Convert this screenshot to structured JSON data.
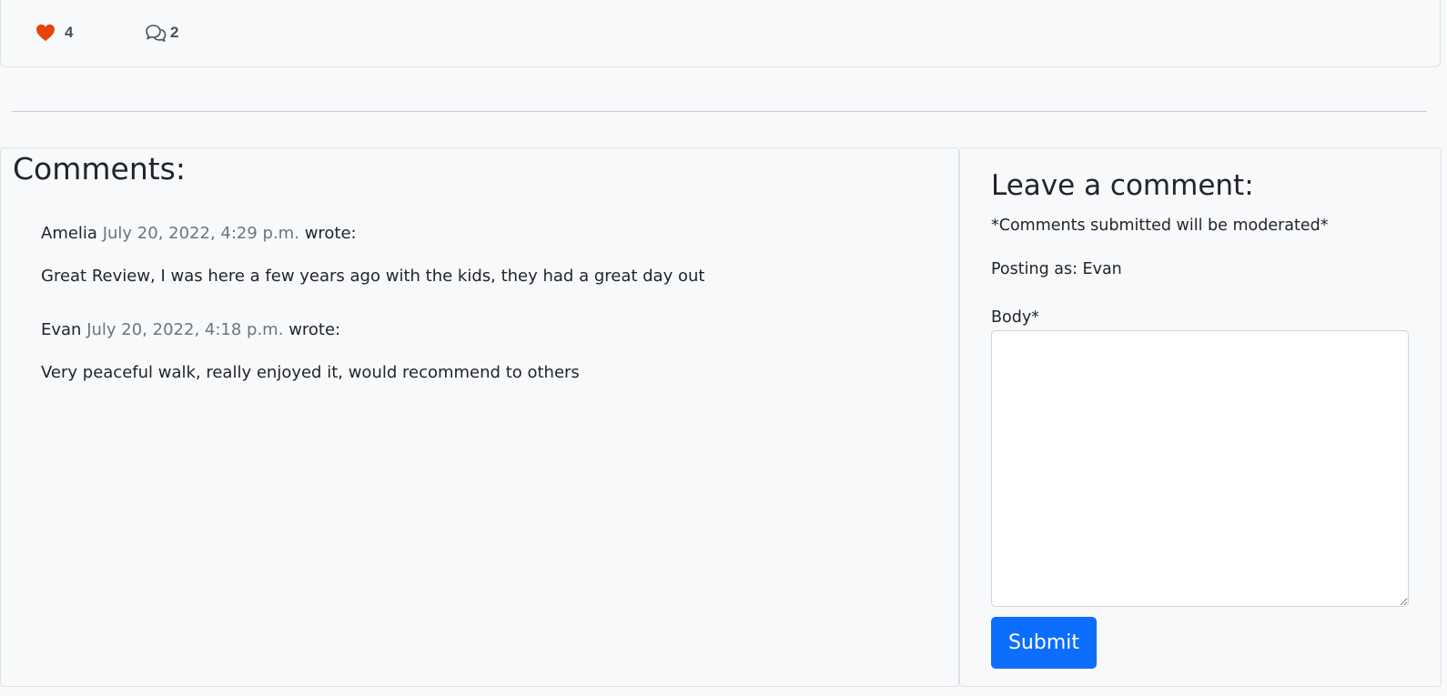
{
  "post_stats": {
    "likes_count": "4",
    "comments_count": "2",
    "like_icon": "heart-icon",
    "comment_icon": "chat-bubbles-icon",
    "like_color": "#e8430e"
  },
  "comments_section": {
    "heading": "Comments:",
    "comments": [
      {
        "author": "Amelia",
        "date": "July 20, 2022, 4:29 p.m.",
        "wrote": "wrote:",
        "body": "Great Review, I was here a few years ago with the kids, they had a great day out"
      },
      {
        "author": "Evan",
        "date": "July 20, 2022, 4:18 p.m.",
        "wrote": "wrote:",
        "body": "Very peaceful walk, really enjoyed it, would recommend to others"
      }
    ]
  },
  "comment_form": {
    "heading": "Leave a comment:",
    "moderation_note": "*Comments submitted will be moderated*",
    "posting_as": "Posting as: Evan",
    "body_label": "Body*",
    "body_value": "",
    "submit_label": "Submit"
  },
  "colors": {
    "primary": "#0d6efd",
    "muted_date": "#6c757d",
    "heart": "#e8430e",
    "page_background": "#f8f9fa"
  }
}
